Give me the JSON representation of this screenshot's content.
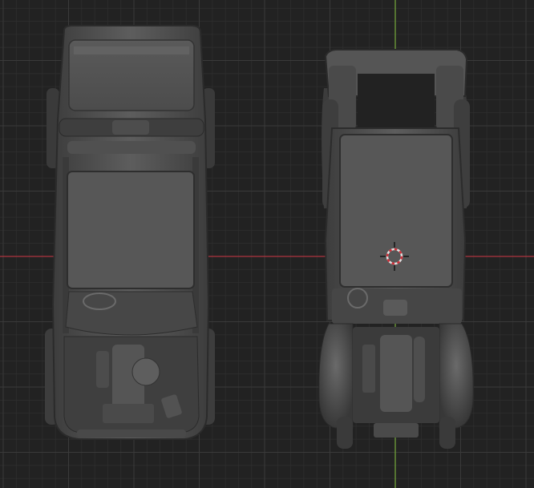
{
  "viewport": {
    "background": "#222222",
    "grid_minor_color": "#2e2e2e",
    "grid_major_color": "#3a3a3a",
    "x_axis_color": "#b0343f",
    "y_axis_color": "#6fa13a",
    "model_base_color": "#555555",
    "model_shadow_color": "#2b2b2b",
    "model_highlight_color": "#7a7a7a"
  },
  "objects": [
    {
      "name": "truck-model-left",
      "label": ""
    },
    {
      "name": "truck-model-right",
      "label": ""
    }
  ],
  "cursor": {
    "icon": "3d-cursor-icon",
    "ring_color": "#e0e0e0",
    "accent_color": "#d0303a"
  }
}
